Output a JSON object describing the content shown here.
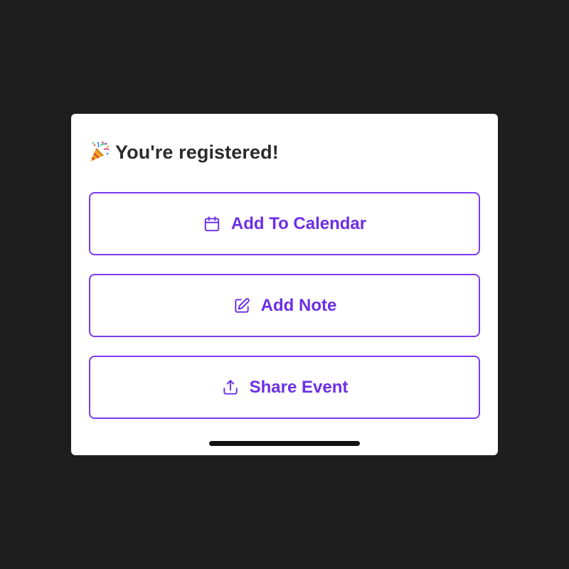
{
  "sheet": {
    "title": "You're registered!",
    "title_icon": "party-popper-icon"
  },
  "actions": [
    {
      "label": "Add To Calendar",
      "icon": "calendar-icon"
    },
    {
      "label": "Add Note",
      "icon": "edit-note-icon"
    },
    {
      "label": "Share Event",
      "icon": "share-icon"
    }
  ],
  "colors": {
    "background": "#1e1e1e",
    "sheet": "#ffffff",
    "accent": "#7c3aed",
    "title_text": "#2b2b2b",
    "home_indicator": "#111111"
  }
}
